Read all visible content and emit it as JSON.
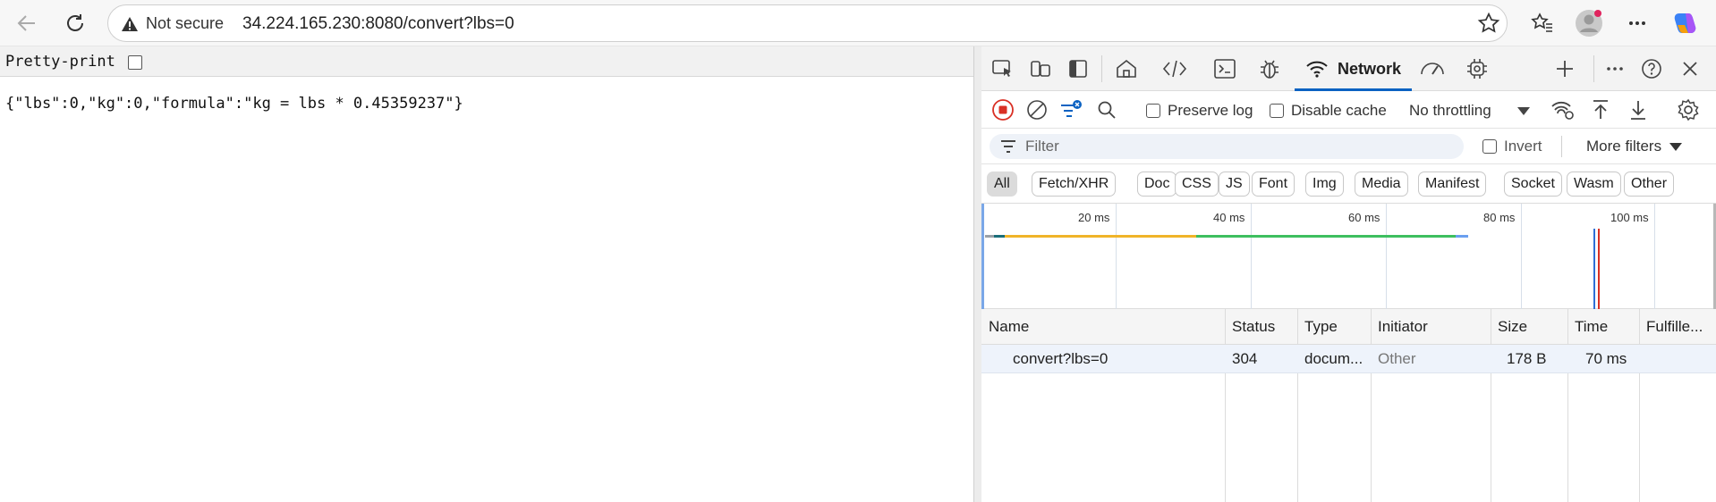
{
  "browser": {
    "security_label": "Not secure",
    "url": "34.224.165.230:8080/convert?lbs=0",
    "icons": [
      "back-icon",
      "refresh-icon",
      "warning-icon",
      "star-icon",
      "favorites-icon",
      "profile-icon",
      "more-icon",
      "copilot-icon"
    ]
  },
  "page": {
    "pretty_print_label": "Pretty-print",
    "json_text": "{\"lbs\":0,\"kg\":0,\"formula\":\"kg = lbs * 0.45359237\"}"
  },
  "devtools": {
    "active_tab_label": "Network",
    "toolbar": {
      "preserve_log_label": "Preserve log",
      "disable_cache_label": "Disable cache",
      "throttling_value": "No throttling"
    },
    "filter": {
      "placeholder": "Filter",
      "invert_label": "Invert",
      "more_filters_label": "More filters"
    },
    "type_filters": [
      "All",
      "Fetch/XHR",
      "Doc",
      "CSS",
      "JS",
      "Font",
      "Img",
      "Media",
      "Manifest",
      "Socket",
      "Wasm",
      "Other"
    ],
    "timeline_ticks": [
      "20 ms",
      "40 ms",
      "60 ms",
      "80 ms",
      "100 ms"
    ],
    "columns": [
      "Name",
      "Status",
      "Type",
      "Initiator",
      "Size",
      "Time",
      "Fulfille..."
    ],
    "rows": [
      {
        "name": "convert?lbs=0",
        "status": "304",
        "type": "docum...",
        "initiator": "Other",
        "size": "178 B",
        "time": "70 ms",
        "fulfilled": ""
      }
    ],
    "colors": {
      "accent": "#0b62c2",
      "waiting": "#f0b429",
      "download": "#3ebf5f",
      "record": "#d93025"
    }
  }
}
